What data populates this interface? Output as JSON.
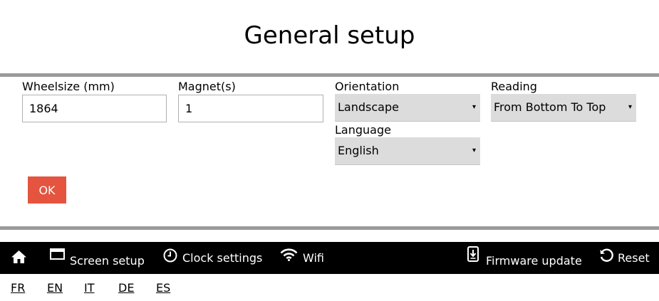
{
  "page": {
    "title": "General setup"
  },
  "form": {
    "wheelsize": {
      "label": "Wheelsize (mm)",
      "value": "1864"
    },
    "magnets": {
      "label": "Magnet(s)",
      "value": "1"
    },
    "orientation": {
      "label": "Orientation",
      "value": "Landscape"
    },
    "reading": {
      "label": "Reading",
      "value": "From Bottom To Top"
    },
    "language": {
      "label": "Language",
      "value": "English"
    },
    "select_arrow": "▾",
    "ok_label": "OK"
  },
  "nav": {
    "items": [
      {
        "label": "",
        "icon": "home-icon"
      },
      {
        "label": "Screen setup",
        "icon": "screen-icon"
      },
      {
        "label": "Clock settings",
        "icon": "clock-icon"
      },
      {
        "label": "Wifi",
        "icon": "wifi-icon"
      },
      {
        "label": "Firmware update",
        "icon": "download-icon"
      },
      {
        "label": "Reset",
        "icon": "reset-icon"
      }
    ]
  },
  "languages": [
    "FR",
    "EN",
    "IT",
    "DE",
    "ES"
  ],
  "colors": {
    "ok_button": "#e4543f",
    "navbar": "#000000",
    "rule": "#9a9a9a",
    "select_background": "#dcdcdc"
  }
}
